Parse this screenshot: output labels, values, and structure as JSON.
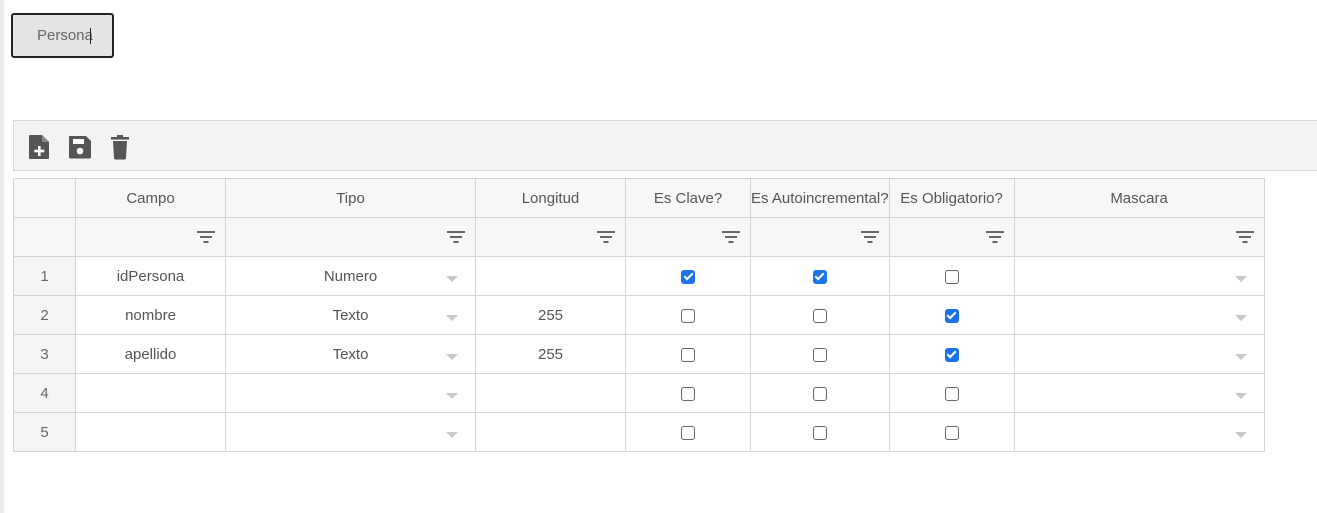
{
  "entity": {
    "name": "Persona"
  },
  "toolbar": {
    "buttons": [
      {
        "icon": "add-file-icon"
      },
      {
        "icon": "save-icon"
      },
      {
        "icon": "trash-icon"
      }
    ]
  },
  "grid": {
    "columns": [
      "Campo",
      "Tipo",
      "Longitud",
      "Es Clave?",
      "Es Autoincremental?",
      "Es Obligatorio?",
      "Mascara"
    ],
    "rows": [
      {
        "num": "1",
        "campo": "idPersona",
        "tipo": "Numero",
        "longitud": "",
        "clave": true,
        "autoinc": true,
        "obligatorio": false,
        "mascara": ""
      },
      {
        "num": "2",
        "campo": "nombre",
        "tipo": "Texto",
        "longitud": "255",
        "clave": false,
        "autoinc": false,
        "obligatorio": true,
        "mascara": ""
      },
      {
        "num": "3",
        "campo": "apellido",
        "tipo": "Texto",
        "longitud": "255",
        "clave": false,
        "autoinc": false,
        "obligatorio": true,
        "mascara": ""
      },
      {
        "num": "4",
        "campo": "",
        "tipo": "",
        "longitud": "",
        "clave": false,
        "autoinc": false,
        "obligatorio": false,
        "mascara": ""
      },
      {
        "num": "5",
        "campo": "",
        "tipo": "",
        "longitud": "",
        "clave": false,
        "autoinc": false,
        "obligatorio": false,
        "mascara": ""
      }
    ]
  },
  "colors": {
    "checkbox_accent": "#1a73e8",
    "icon": "#555555"
  }
}
